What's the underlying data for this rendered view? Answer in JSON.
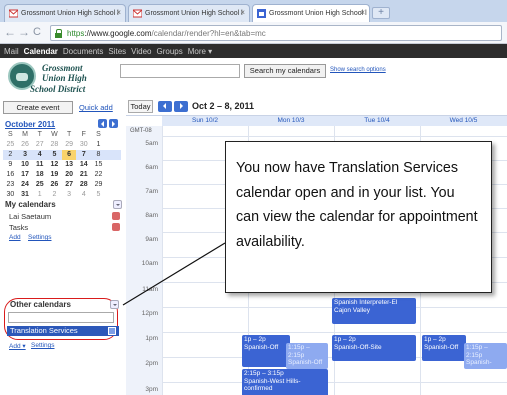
{
  "browser": {
    "tabs": [
      {
        "label": "Grossmont Union High School l",
        "active": false
      },
      {
        "label": "Grossmont Union High School l",
        "active": false
      },
      {
        "label": "Grossmont Union High School l",
        "active": true
      }
    ],
    "url_scheme": "https",
    "url_host": "://www.google.com",
    "url_path": "/calendar/render?hl=en&tab=mc"
  },
  "gbar": {
    "items": [
      "Mail",
      "Calendar",
      "Documents",
      "Sites",
      "Video",
      "Groups",
      "More ▾"
    ],
    "active": "Calendar"
  },
  "logo": {
    "line1": "Grossmont",
    "line2": "Union High",
    "line3": "School District"
  },
  "search": {
    "button": "Search my calendars",
    "options_link": "Show search options"
  },
  "left": {
    "create_event": "Create event",
    "quick_add": "Quick add",
    "mini_title": "October 2011",
    "weekdays": [
      "S",
      "M",
      "T",
      "W",
      "T",
      "F",
      "S"
    ],
    "weeks": [
      [
        "25",
        "26",
        "27",
        "28",
        "29",
        "30",
        "1"
      ],
      [
        "2",
        "3",
        "4",
        "5",
        "6",
        "7",
        "8"
      ],
      [
        "9",
        "10",
        "11",
        "12",
        "13",
        "14",
        "15"
      ],
      [
        "16",
        "17",
        "18",
        "19",
        "20",
        "21",
        "22"
      ],
      [
        "23",
        "24",
        "25",
        "26",
        "27",
        "28",
        "29"
      ],
      [
        "30",
        "31",
        "1",
        "2",
        "3",
        "4",
        "5"
      ]
    ],
    "my_calendars_title": "My calendars",
    "my_calendars": [
      {
        "name": "Lai Saetaum",
        "color": "#d96666"
      },
      {
        "name": "Tasks",
        "color": "#d96666"
      }
    ],
    "my_links": {
      "add": "Add",
      "settings": "Settings"
    },
    "other_calendars_title": "Other calendars",
    "other_calendars": [
      {
        "name": "Translation Services",
        "color": "#7d9ee6"
      }
    ],
    "other_links": {
      "add": "Add ▾",
      "settings": "Settings"
    }
  },
  "calendar": {
    "today": "Today",
    "range": "Oct 2 – 8, 2011",
    "timezone": "GMT-08",
    "days": [
      "Sun 10/2",
      "Mon 10/3",
      "Tue 10/4",
      "Wed 10/5"
    ],
    "hours": [
      "5am",
      "6am",
      "7am",
      "8am",
      "9am",
      "10am",
      "11am",
      "12pm",
      "1pm",
      "2pm",
      "3pm"
    ],
    "events": [
      {
        "id": "mon-12",
        "title": "Spanish Interpreter-El Cajon Valley",
        "time": "",
        "style": "dark"
      },
      {
        "id": "sun-1",
        "title": "Spanish-Off",
        "time": "1p – 2p",
        "style": "dark"
      },
      {
        "id": "sun-1b",
        "title": "Spanish-Off",
        "time": "1:15p – 2:15p",
        "style": "light"
      },
      {
        "id": "mon-1",
        "title": "Spanish-Off-Site",
        "time": "1p – 2p",
        "style": "dark"
      },
      {
        "id": "tue-1",
        "title": "Spanish-Off",
        "time": "1p – 2p",
        "style": "dark"
      },
      {
        "id": "tue-1b",
        "title": "Spanish-",
        "time": "1:15p – 2:15p",
        "style": "light"
      },
      {
        "id": "sun-2",
        "title": "Spanish-West Hills-confirmed",
        "time": "2:15p – 3:15p",
        "style": "dark"
      }
    ]
  },
  "callout": {
    "text": "You now have Translation Services calendar open and in your list.  You can view  the  calendar for appointment availability."
  },
  "colors": {
    "accent": "#3b64d3",
    "highlight_ring": "#d91b1b",
    "today": "#f9d36b"
  }
}
